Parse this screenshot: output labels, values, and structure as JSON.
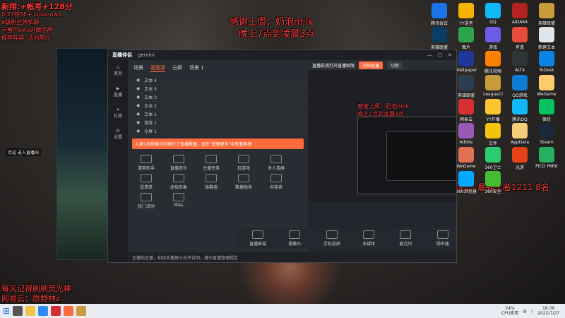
{
  "overlay": {
    "top_left_lines": [
      "新排:+帐号+128分",
      "0:23铁5E+ Linzz-owo",
      "6级粉丝牌私聊",
      "卡蜜尔owo进微信群",
      "推荐阵容: 法师熬兴"
    ],
    "header_line1": "感谢上周：奶泡milk",
    "header_line2": "晚上7点到凌晨3点",
    "rank_text": "双人段位: 最强王者1211 8名",
    "bottom_left_1": "每天记得刷刷荧光棒",
    "bottom_left_2": "网易云：原野林z",
    "welcome": "欢迎 进入直播间"
  },
  "app": {
    "logo": "直播伴侣",
    "window_title": "gemini",
    "sidebar": [
      {
        "label": "首页",
        "icon": "home-icon"
      },
      {
        "label": "直播",
        "icon": "live-icon"
      },
      {
        "label": "礼物",
        "icon": "gift-icon"
      },
      {
        "label": "设置",
        "icon": "settings-icon"
      }
    ],
    "tabs": [
      "场景",
      "画面源",
      "分屏",
      "场景 1"
    ],
    "sources": [
      "文本 4",
      "文本 5",
      "文本 3",
      "文本 2",
      "文本 1",
      "游戏 1",
      "全屏 1"
    ],
    "toast": "上周1月排播号切换行了直播数据，现在\"管理更多\"中查看明细",
    "tools": [
      "清爽助手",
      "直播音乐",
      "主播任务",
      "玩游戏",
      "多人连屏",
      "送清单",
      "虚拟形象",
      "弹幕墙",
      "数据助手",
      "中奖表",
      "热门活动",
      "Miss"
    ],
    "preview_line1": "感谢上周：奶泡milk",
    "preview_line2": "晚上7点到凌晨3点",
    "stream_notice": "直播前请打开直播权限",
    "start_button": "开始直播",
    "switch_button": "切换",
    "bottom_tools": [
      "直播屏幕",
      "摄像头",
      "手机投屏",
      "多媒体",
      "麦克风",
      "扬声器"
    ],
    "status": "主播助主播，知晓关播屏公告并说明，遵守直播管理规定"
  },
  "desktop_icons": [
    [
      "腾讯会议",
      "#1a73e8"
    ],
    [
      "YY语音",
      "#f6b400"
    ],
    [
      "QQ",
      "#12b7f5"
    ],
    [
      "AIDA64",
      "#b22222"
    ],
    [
      "英雄联盟",
      "#c89b3c"
    ],
    [
      "英雄联盟",
      "#0a3d62"
    ],
    [
      "图片",
      "#2ea44f"
    ],
    [
      "游戏",
      "#6c5ce7"
    ],
    [
      "有道",
      "#e74c3c"
    ],
    [
      "新建文本",
      "#dfe6e9"
    ],
    [
      "PUBG",
      "#f39c12"
    ],
    [
      "Wallpaper",
      "#1e3799"
    ],
    [
      "腾讯视频",
      "#ff7f00"
    ],
    [
      "ALT4",
      "#2d3436"
    ],
    [
      "ToDesk",
      "#0984e3"
    ],
    [
      "爱奇艺",
      "#00b894"
    ],
    [
      "英雄联盟",
      "#2c3e50"
    ],
    [
      "LeagueCl",
      "#c89b3c"
    ],
    [
      "QQ游戏",
      "#0c7cd5"
    ],
    [
      "WeGame",
      "#fdcb6e"
    ],
    [
      "QQ音乐",
      "#31c27c"
    ],
    [
      "网易云",
      "#d63031"
    ],
    [
      "YY开播",
      "#fbc531"
    ],
    [
      "腾讯QQ",
      "#12b7f5"
    ],
    [
      "微信",
      "#07c160"
    ],
    [
      "Edge",
      "#0078d7"
    ],
    [
      "Adobe",
      "#9b59b6"
    ],
    [
      "文件",
      "#f1c40f"
    ],
    [
      "AppData",
      "#f5cd79"
    ],
    [
      "Steam",
      "#1b2838"
    ],
    [
      "英雄联盟",
      "#c89b3c"
    ],
    [
      "WeGame",
      "#e17055"
    ],
    [
      "360卫士",
      "#2ecc71"
    ],
    [
      "迅游",
      "#e84118"
    ],
    [
      "PICO PARK",
      "#27ae60"
    ],
    [
      "LeagueCl",
      "#c89b3c"
    ],
    [
      "360浏览器",
      "#00a8ff"
    ],
    [
      "360安全",
      "#44bd32"
    ]
  ],
  "taskbar": {
    "cpu": "24%",
    "cpu_label": "CPU使用",
    "time": "18:36",
    "date": "2022/7/27"
  }
}
